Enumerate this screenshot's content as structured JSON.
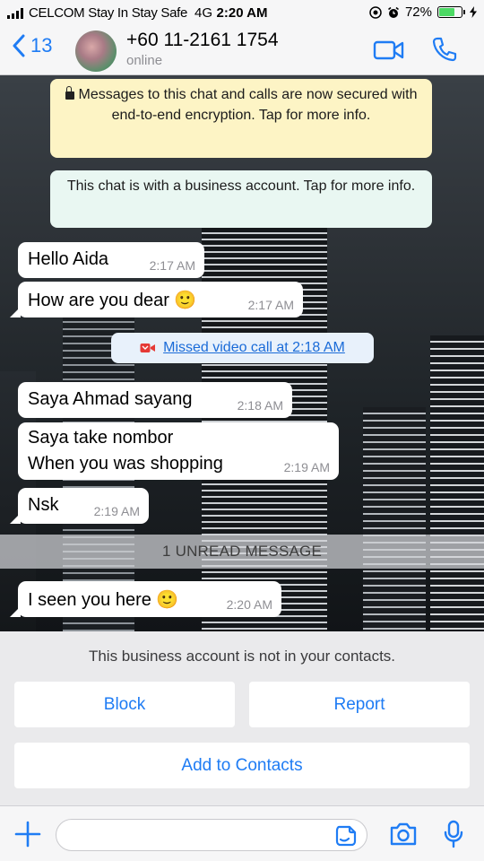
{
  "status_bar": {
    "carrier": "CELCOM Stay In Stay Safe",
    "network": "4G",
    "time": "2:20 AM",
    "battery_percent_label": "72%",
    "battery_level": 0.72
  },
  "header": {
    "back_count": "13",
    "contact_name": "+60 11-2161 1754",
    "contact_status": "online"
  },
  "chat": {
    "encryption_notice": "Messages to this chat and calls are now secured with end-to-end encryption. Tap for more info.",
    "business_notice": "This chat is with a business account. Tap for more info.",
    "messages": [
      {
        "text": "Hello Aida",
        "time": "2:17 AM"
      },
      {
        "text": "How are you dear 🙂",
        "time": "2:17 AM"
      },
      {
        "text": "Saya Ahmad sayang",
        "time": "2:18 AM"
      },
      {
        "lines": [
          "Saya take nombor",
          "When you was shopping"
        ],
        "time": "2:19 AM"
      },
      {
        "text": "Nsk",
        "time": "2:19 AM"
      },
      {
        "text": "I seen you here 🙂",
        "time": "2:20 AM"
      }
    ],
    "missed_call": "Missed video call at 2:18 AM",
    "unread_divider": "1 UNREAD MESSAGE"
  },
  "business_banner": {
    "note": "This business account is not in your contacts.",
    "block_label": "Block",
    "report_label": "Report",
    "add_label": "Add to Contacts"
  },
  "input_bar": {
    "message_value": ""
  },
  "colors": {
    "accent": "#1f7cf4",
    "encryption_bg": "#fdf4c5",
    "business_bg": "#e9f7f2",
    "missed_call_icon": "#e53935",
    "battery": "#4cd964"
  },
  "icons": [
    "signal-icon",
    "location-icon",
    "alarm-icon",
    "battery-icon",
    "charging-icon",
    "back-chevron-icon",
    "video-call-icon",
    "voice-call-icon",
    "lock-icon",
    "missed-video-call-icon",
    "plus-icon",
    "sticker-icon",
    "camera-icon",
    "mic-icon"
  ]
}
